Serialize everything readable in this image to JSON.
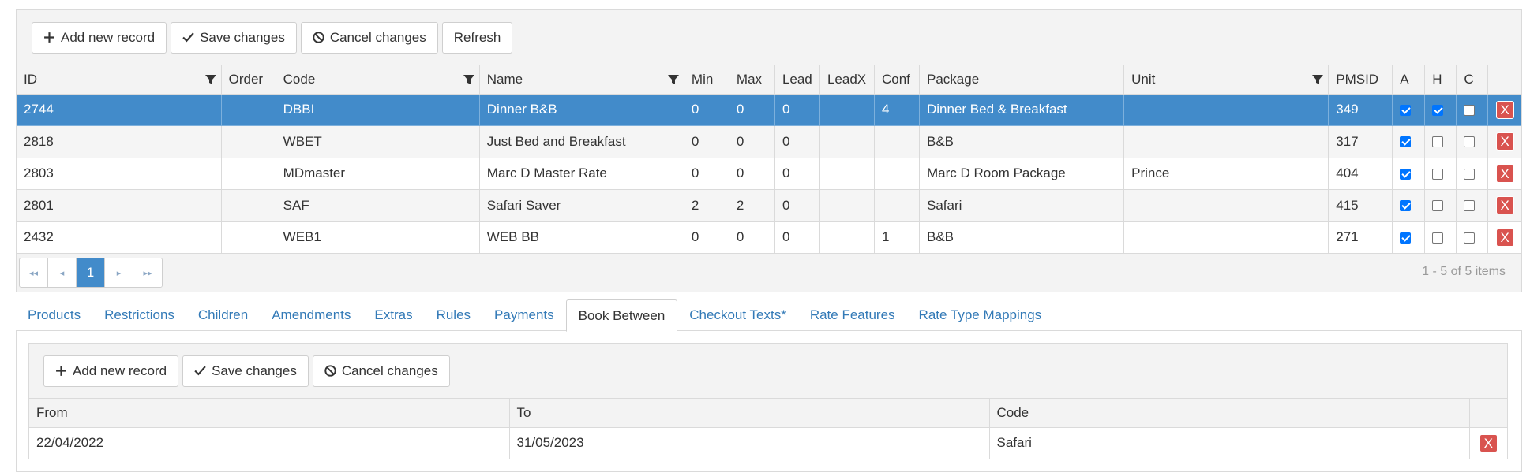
{
  "toolbar": {
    "add_label": "Add new record",
    "save_label": "Save changes",
    "cancel_label": "Cancel changes",
    "refresh_label": "Refresh"
  },
  "columns": [
    "ID",
    "Order",
    "Code",
    "Name",
    "Min",
    "Max",
    "Lead",
    "LeadX",
    "Conf",
    "Package",
    "Unit",
    "PMSID",
    "A",
    "H",
    "C"
  ],
  "rows": [
    {
      "id": "2744",
      "order": "",
      "code": "DBBI",
      "name": "Dinner B&B",
      "min": "0",
      "max": "0",
      "lead": "0",
      "leadx": "",
      "conf": "4",
      "package": "Dinner Bed & Breakfast",
      "unit": "",
      "pmsid": "349",
      "a": true,
      "h": true,
      "c": false,
      "selected": true
    },
    {
      "id": "2818",
      "order": "",
      "code": "WBET",
      "name": "Just Bed and Breakfast",
      "min": "0",
      "max": "0",
      "lead": "0",
      "leadx": "",
      "conf": "",
      "package": "B&B",
      "unit": "",
      "pmsid": "317",
      "a": true,
      "h": false,
      "c": false
    },
    {
      "id": "2803",
      "order": "",
      "code": "MDmaster",
      "name": "Marc D Master Rate",
      "min": "0",
      "max": "0",
      "lead": "0",
      "leadx": "",
      "conf": "",
      "package": "Marc D Room Package",
      "unit": "Prince",
      "pmsid": "404",
      "a": true,
      "h": false,
      "c": false
    },
    {
      "id": "2801",
      "order": "",
      "code": "SAF",
      "name": "Safari Saver",
      "min": "2",
      "max": "2",
      "lead": "0",
      "leadx": "",
      "conf": "",
      "package": "Safari",
      "unit": "",
      "pmsid": "415",
      "a": true,
      "h": false,
      "c": false
    },
    {
      "id": "2432",
      "order": "",
      "code": "WEB1",
      "name": "WEB BB",
      "min": "0",
      "max": "0",
      "lead": "0",
      "leadx": "",
      "conf": "1",
      "package": "B&B",
      "unit": "",
      "pmsid": "271",
      "a": true,
      "h": false,
      "c": false
    }
  ],
  "delete_label": "X",
  "pager": {
    "current_page": "1",
    "info": "1 - 5 of 5 items"
  },
  "tabs": [
    "Products",
    "Restrictions",
    "Children",
    "Amendments",
    "Extras",
    "Rules",
    "Payments",
    "Book Between",
    "Checkout Texts*",
    "Rate Features",
    "Rate Type Mappings"
  ],
  "active_tab": "Book Between",
  "sub_grid": {
    "toolbar": {
      "add_label": "Add new record",
      "save_label": "Save changes",
      "cancel_label": "Cancel changes"
    },
    "columns": [
      "From",
      "To",
      "Code"
    ],
    "rows": [
      {
        "from": "22/04/2022",
        "to": "31/05/2023",
        "code": "Safari"
      }
    ]
  },
  "colors": {
    "selected_row": "#428bca",
    "link": "#337ab7",
    "delete": "#d9534f",
    "checkbox": "#0075ff"
  },
  "icons": {
    "add": "plus-icon",
    "save": "check-icon",
    "cancel": "cancel-icon",
    "filter": "filter-icon",
    "pager_first": "first-page-icon",
    "pager_prev": "prev-page-icon",
    "pager_next": "next-page-icon",
    "pager_last": "last-page-icon"
  }
}
